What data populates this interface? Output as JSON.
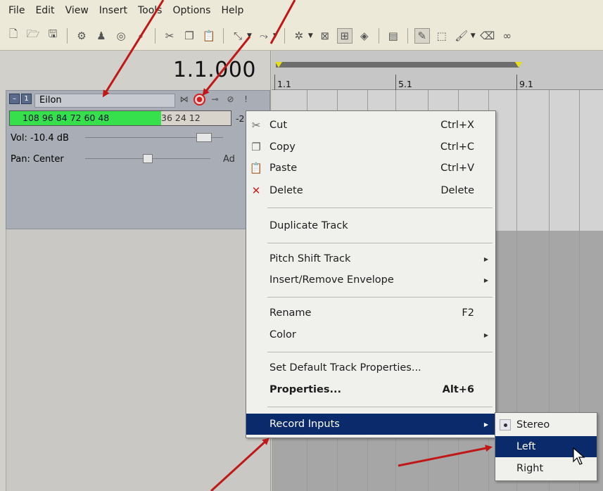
{
  "menubar": {
    "items": [
      "File",
      "Edit",
      "View",
      "Insert",
      "Tools",
      "Options",
      "Help"
    ]
  },
  "toolbar": {
    "icons": [
      "new-file-icon",
      "open-folder-icon",
      "save-icon",
      "properties-icon",
      "person-icon",
      "burn-icon",
      "search-icon",
      "cut-icon",
      "copy-icon",
      "paste-icon",
      "edit-tool-icon",
      "envelope-tool-icon",
      "split-icon",
      "region-icon",
      "snap-icon",
      "auto-ripple-icon",
      "lock-icon",
      "draw-icon",
      "select-icon",
      "paint-icon",
      "erase-icon",
      "mute-tool-icon"
    ]
  },
  "transport": {
    "timecode": "1.1.000"
  },
  "track": {
    "number": "1",
    "name": "Eilon",
    "meter_active_text": "108  96  84  72  60  48",
    "meter_inactive_text": "36  24  12",
    "meter_tail": "-2",
    "volume_label": "Vol: -10.4 dB",
    "pan_label": "Pan:  Center",
    "automation_label": "Ad",
    "meter_level": 0.68,
    "volume_level": 0.65,
    "pan_level": 0.5
  },
  "ruler": {
    "ticks": [
      "1.1",
      "5.1",
      "9.1"
    ]
  },
  "context_menu": {
    "items": [
      {
        "icon": "cut-icon",
        "label": "Cut",
        "shortcut": "Ctrl+X"
      },
      {
        "icon": "copy-icon",
        "label": "Copy",
        "shortcut": "Ctrl+C"
      },
      {
        "icon": "paste-icon",
        "label": "Paste",
        "shortcut": "Ctrl+V"
      },
      {
        "icon": "delete-icon",
        "label": "Delete",
        "shortcut": "Delete"
      },
      {
        "label": "Duplicate Track"
      },
      {
        "label": "Pitch Shift Track"
      },
      {
        "label": "Insert/Remove Envelope"
      },
      {
        "label": "Rename",
        "shortcut": "F2"
      },
      {
        "label": "Color"
      },
      {
        "label": "Set Default Track Properties..."
      },
      {
        "label": "Properties...",
        "shortcut": "Alt+6"
      },
      {
        "label": "Record Inputs"
      }
    ]
  },
  "submenu": {
    "items": [
      "Stereo",
      "Left",
      "Right"
    ],
    "selected": "Stereo",
    "highlighted": "Left"
  },
  "colors": {
    "menu_highlight": "#0b2a6b",
    "meter_green": "#35e04c",
    "record_red": "#d02020",
    "annotation_arrow": "#c01818"
  }
}
